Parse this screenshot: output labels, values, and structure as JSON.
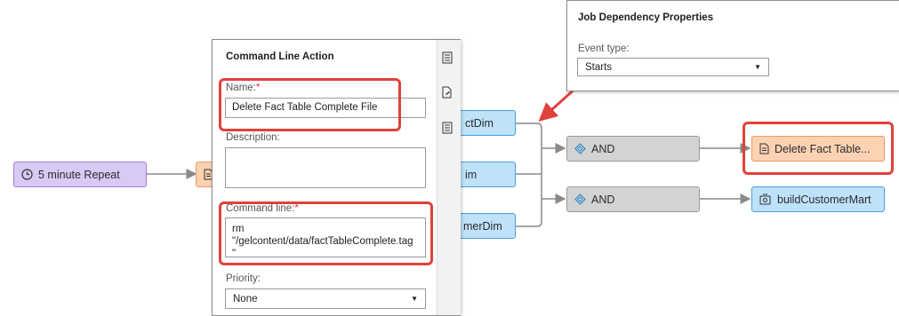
{
  "flow": {
    "timer_label": "5 minute Repeat",
    "job1_label": "ctDim",
    "job2_label": "im",
    "job3_label": "merDim",
    "gate1_label": "AND",
    "gate2_label": "AND",
    "cmd_node_label": "Delete Fact Table...",
    "job_node_label": "buildCustomerMart"
  },
  "command_panel": {
    "title": "Command Line Action",
    "name_label": "Name:",
    "name_required": "*",
    "name_value": "Delete Fact Table Complete File",
    "description_label": "Description:",
    "description_value": "",
    "command_label": "Command line:",
    "command_required": "*",
    "command_line1": "rm",
    "command_line2": "\"/gelcontent/data/factTableComplete.tag",
    "command_line3": "\"",
    "priority_label": "Priority:",
    "priority_value": "None"
  },
  "dependency_panel": {
    "title": "Job Dependency Properties",
    "event_type_label": "Event type:",
    "event_type_value": "Starts"
  },
  "colors": {
    "highlight": "#e0413b",
    "timer": "#d9c9f5",
    "job": "#bfe2fb",
    "gate": "#d3d3d3",
    "command": "#fcd2b3"
  }
}
